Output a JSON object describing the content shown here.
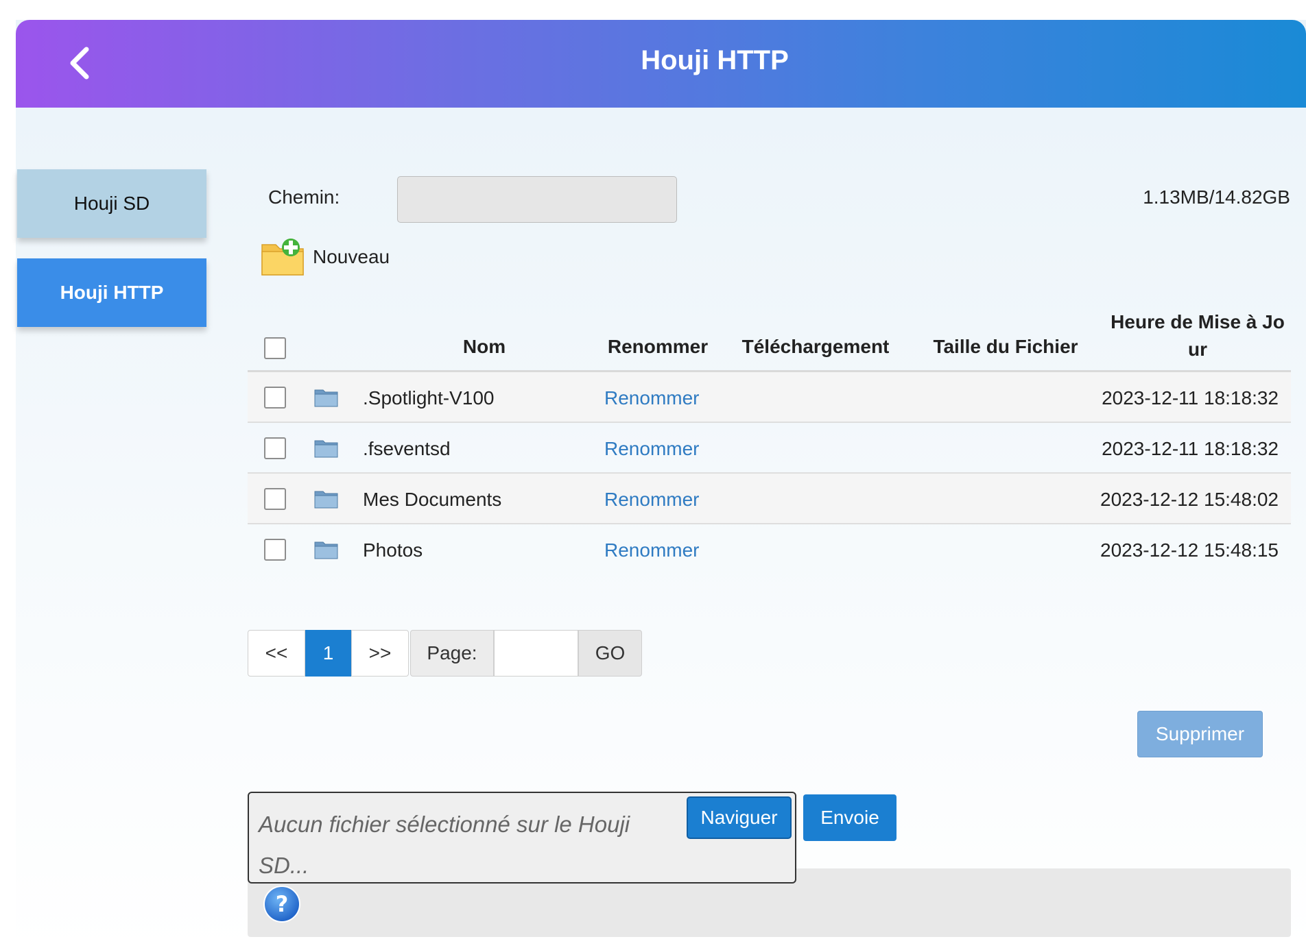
{
  "header": {
    "title": "Houji HTTP",
    "back_icon": "chevron-left-icon"
  },
  "sidebar": {
    "items": [
      {
        "label": "Houji SD",
        "active": false
      },
      {
        "label": "Houji HTTP",
        "active": true
      }
    ]
  },
  "path": {
    "label": "Chemin:",
    "value": ""
  },
  "storage": {
    "usage": "1.13MB/14.82GB"
  },
  "new_folder": {
    "label": "Nouveau",
    "icon": "new-folder-icon"
  },
  "table": {
    "headers": {
      "name": "Nom",
      "rename": "Renommer",
      "download": "Téléchargement",
      "size": "Taille du Fichier",
      "modified_line1": "Heure de Mise à Jo",
      "modified_line2": "ur"
    },
    "rows": [
      {
        "name": ".Spotlight-V100",
        "rename": "Renommer",
        "download": "",
        "size": "",
        "modified": "2023-12-11 18:18:32"
      },
      {
        "name": ".fseventsd",
        "rename": "Renommer",
        "download": "",
        "size": "",
        "modified": "2023-12-11 18:18:32"
      },
      {
        "name": "Mes Documents",
        "rename": "Renommer",
        "download": "",
        "size": "",
        "modified": "2023-12-12 15:48:02"
      },
      {
        "name": "Photos",
        "rename": "Renommer",
        "download": "",
        "size": "",
        "modified": "2023-12-12 15:48:15"
      }
    ]
  },
  "pagination": {
    "prev": "<<",
    "current": "1",
    "next": ">>",
    "page_label": "Page:",
    "page_value": "",
    "go": "GO"
  },
  "actions": {
    "delete": "Supprimer"
  },
  "upload": {
    "file_status": "Aucun fichier sélectionné sur le Houji SD...",
    "browse": "Naviguer",
    "send": "Envoie",
    "help_icon": "help-icon"
  },
  "colors": {
    "header_start": "#9b55ec",
    "header_end": "#1a8ad6",
    "accent": "#1b7fd1",
    "link": "#2f7bc2"
  }
}
